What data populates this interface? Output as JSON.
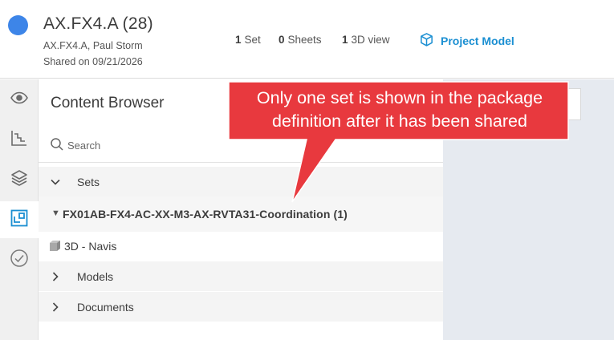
{
  "header": {
    "title": "AX.FX4.A (28)",
    "meta": "AX.FX4.A, Paul Storm",
    "shared": "Shared on 09/21/2026",
    "stats": {
      "sets_count": "1",
      "sets_label": "Set",
      "sheets_count": "0",
      "sheets_label": "Sheets",
      "views_count": "1",
      "views_label": "3D view"
    },
    "project_link": "Project Model"
  },
  "rail": {
    "icons": [
      "eye-icon",
      "chart-steps-icon",
      "layers-icon",
      "sheet-browser-icon",
      "check-circle-icon"
    ],
    "active": "sheet-browser-icon"
  },
  "browser": {
    "title": "Content Browser",
    "search_placeholder": "Search",
    "sets_label": "Sets",
    "set_name": "FX01AB-FX4-AC-XX-M3-AX-RVTA31-Coordination (1)",
    "set_item": "3D - Navis",
    "models_label": "Models",
    "documents_label": "Documents"
  },
  "callout": {
    "line1": "Only one set is shown in the package",
    "line2": "definition after it has been shared"
  },
  "colors": {
    "accent": "#1b8fd2",
    "status_dot": "#3d85e8",
    "callout": "#e8393e"
  }
}
